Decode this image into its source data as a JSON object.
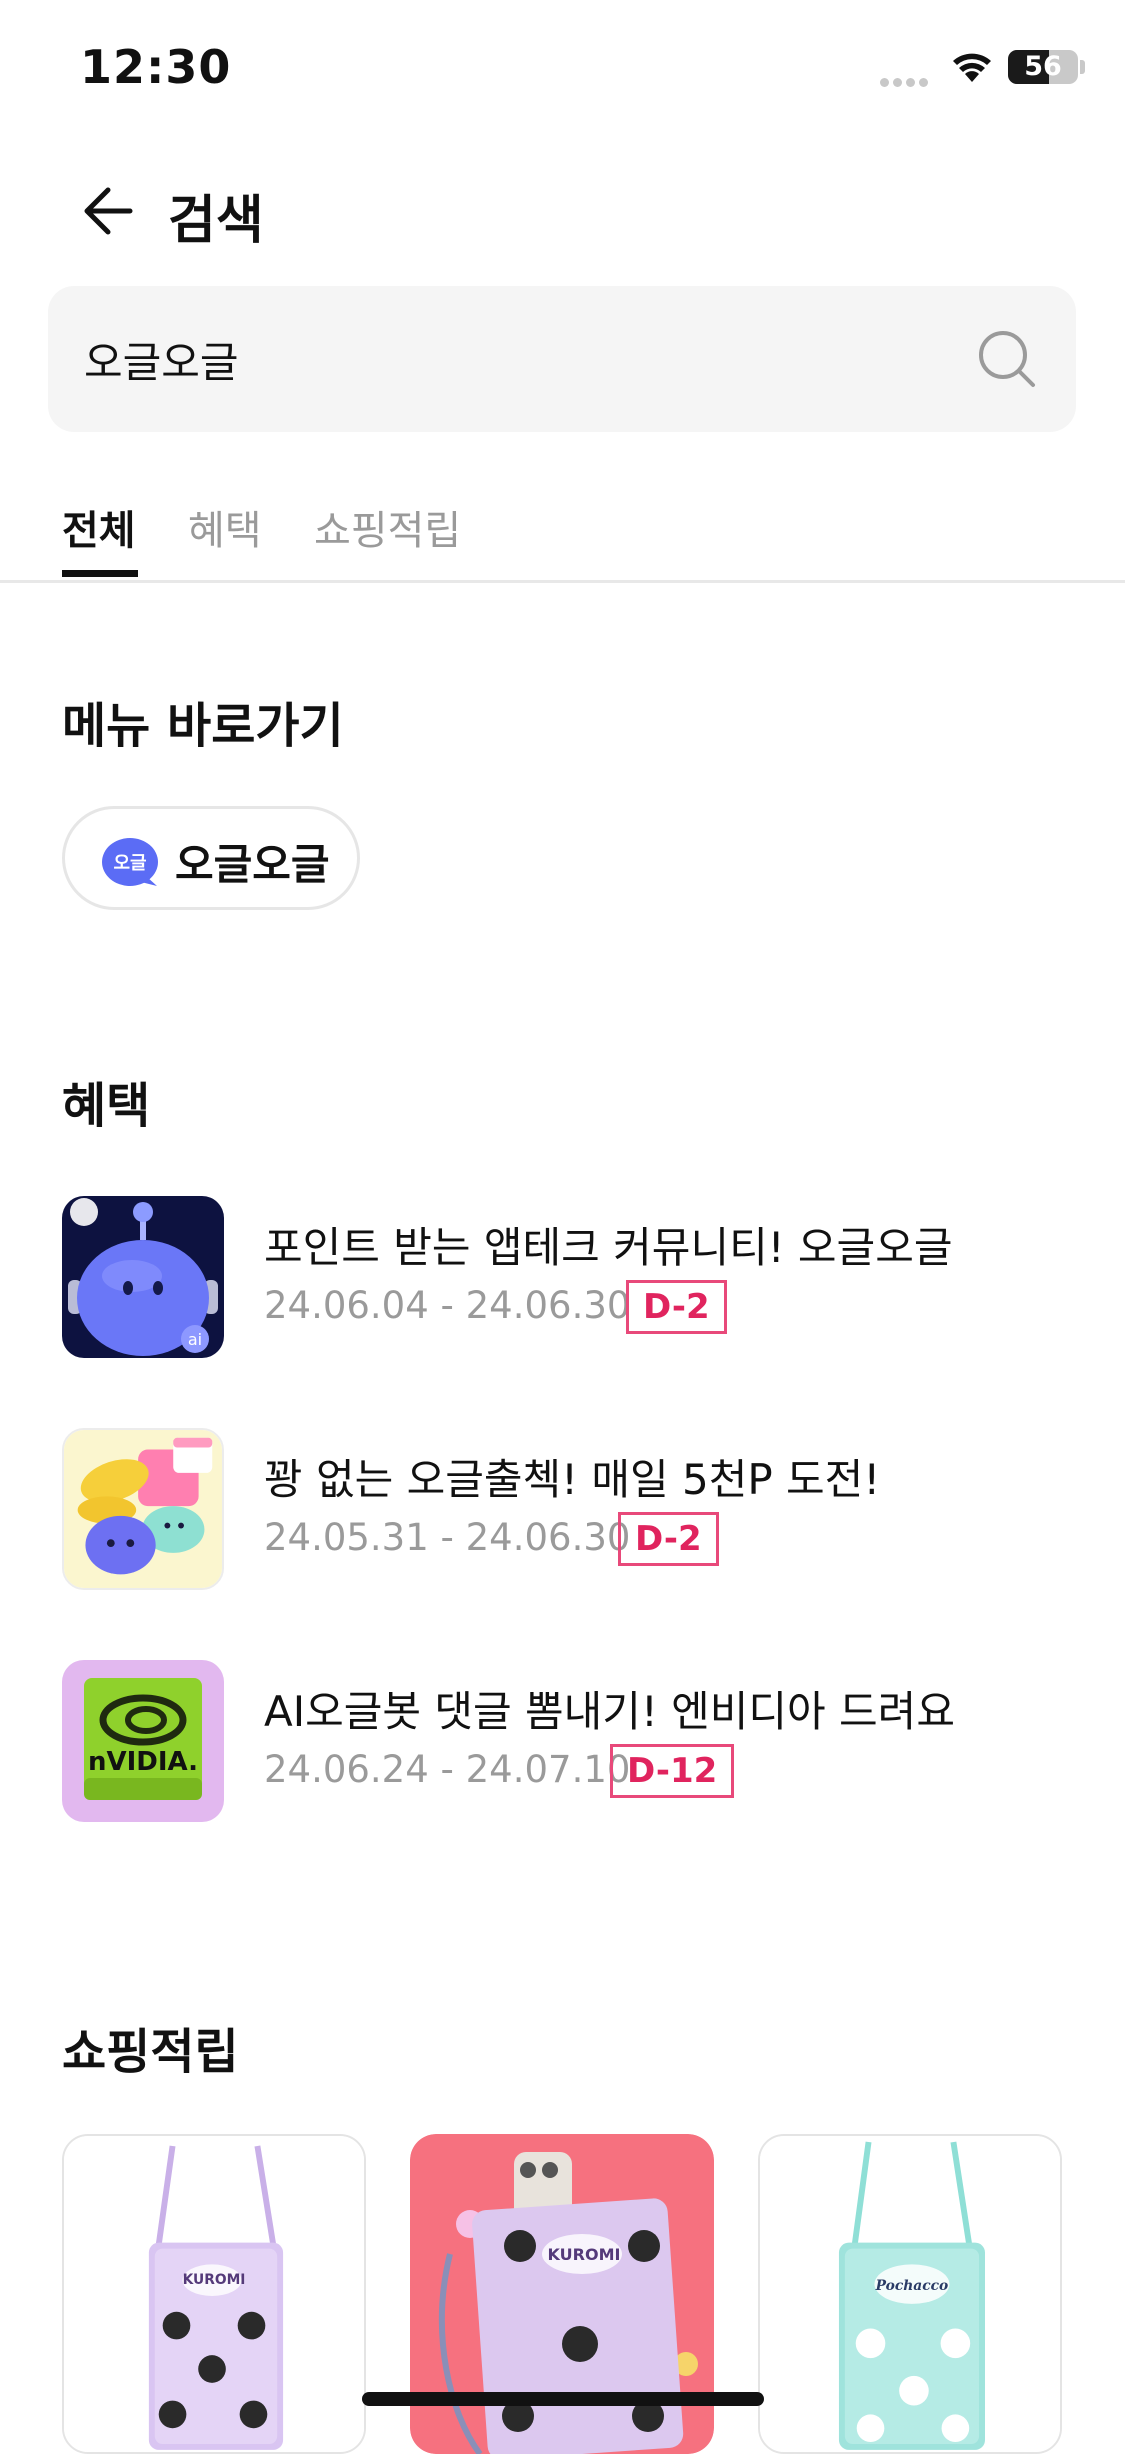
{
  "status_bar": {
    "time": "12:30",
    "battery": "56"
  },
  "header": {
    "title": "검색",
    "back_icon": "arrow-left-icon"
  },
  "search": {
    "value": "오글오글",
    "placeholder": ""
  },
  "tabs": [
    {
      "label": "전체",
      "active": true
    },
    {
      "label": "혜택",
      "active": false
    },
    {
      "label": "쇼핑적립",
      "active": false
    }
  ],
  "menu_shortcuts": {
    "title": "메뉴 바로가기",
    "items": [
      {
        "label": "오글오글",
        "icon_text": "오글",
        "icon": "chat-bubble-icon"
      }
    ]
  },
  "benefits": {
    "title": "혜택",
    "items": [
      {
        "title": "포인트 받는 앱테크 커뮤니티! 오글오글",
        "date": "24.06.04 - 24.06.30",
        "badge": "D-2",
        "thumb": "robot-character-image"
      },
      {
        "title": "꽝 없는 오글출첵! 매일 5천P 도전!",
        "date": "24.05.31 - 24.06.30",
        "badge": "D-2",
        "thumb": "calendar-characters-image"
      },
      {
        "title": "AI오글봇 댓글 뽐내기! 엔비디아 드려요",
        "date": "24.06.24 - 24.07.10",
        "badge": "D-12",
        "thumb": "nvidia-logo-image",
        "thumb_text": "nVIDIA."
      }
    ]
  },
  "shopping": {
    "title": "쇼핑적립",
    "items": [
      {
        "name": "kuromi-pouch-lavender",
        "brand_text": "KUROMI"
      },
      {
        "name": "kuromi-phone-pouch-pink",
        "brand_text": "KUROMI"
      },
      {
        "name": "pochacco-pouch-mint",
        "brand_text": "Pochacco"
      }
    ]
  },
  "colors": {
    "accent": "#e0245e",
    "chip_icon": "#5b6cf5",
    "search_bg": "#f5f5f5"
  }
}
